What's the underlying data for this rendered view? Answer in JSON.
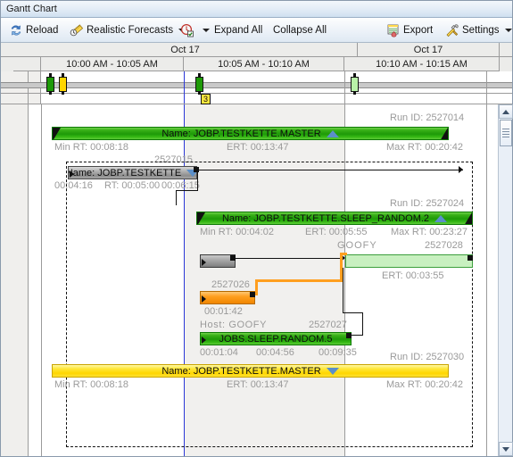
{
  "window": {
    "title": "Gantt Chart"
  },
  "toolbar": {
    "reload": {
      "label": "Reload",
      "icon": "reload-icon"
    },
    "forecasts": {
      "label": "Realistic Forecasts",
      "icon": "forecast-ruler-icon"
    },
    "filter": {
      "label": "",
      "icon": "filter-clock-icon"
    },
    "expand_all": {
      "label": "Expand All"
    },
    "collapse_all": {
      "label": "Collapse All"
    },
    "export": {
      "label": "Export",
      "icon": "export-icon"
    },
    "settings": {
      "label": "Settings",
      "icon": "settings-tools-icon"
    }
  },
  "timescale": {
    "days": [
      {
        "label": "Oct 17"
      },
      {
        "label": "Oct 17"
      }
    ],
    "slots": [
      {
        "label": "10:00 AM - 10:05 AM"
      },
      {
        "label": "10:05 AM - 10:10 AM"
      },
      {
        "label": "10:10 AM - 10:15 AM"
      }
    ]
  },
  "markers": {
    "badge_label": "3",
    "items": [
      {
        "name": "marker-green-1",
        "color": "#1e9a08"
      },
      {
        "name": "marker-yellow-1",
        "color": "#ffd600"
      },
      {
        "name": "marker-green-2",
        "color": "#1e9a08"
      },
      {
        "name": "marker-lightgreen-3",
        "color": "#9bee8a"
      }
    ]
  },
  "rows": [
    {
      "id": "row-master-green",
      "run_id": "Run ID: 2527014",
      "bar_label": "Name: JOBP.TESTKETTE.MASTER",
      "min_rt": "Min RT: 00:08:18",
      "ert": "ERT: 00:13:47",
      "max_rt": "Max RT: 00:20:42",
      "tail_id": "2527015",
      "color": "#1e9a08",
      "expander": "triangle-up"
    },
    {
      "id": "row-testkette-gray",
      "bar_label": "Name: JOBP.TESTKETTE",
      "t_start": "00:04:16",
      "t_rt": "RT: 00:05:00",
      "t_end": "00:06:15",
      "color": "#8d8d8d",
      "expander": "triangle-down"
    },
    {
      "id": "row-sleep-random-2",
      "run_id": "Run ID: 2527024",
      "bar_label": "Name: JOBP.TESTKETTE.SLEEP_RANDOM.2",
      "min_rt": "Min RT: 00:04:02",
      "ert": "ERT: 00:05:55",
      "max_rt": "Max RT: 00:23:27",
      "color": "#1e9a08",
      "expander": "triangle-up"
    },
    {
      "id": "row-goofy-ltgreen",
      "host": "GOOFY",
      "run_id": "2527028",
      "ert": "ERT: 00:03:55",
      "color": "#c8f0c0"
    },
    {
      "id": "row-orange",
      "run_id": "2527026",
      "duration": "00:01:42",
      "color": "#ff9f1f"
    },
    {
      "id": "row-jobs-sleep-random-5",
      "host": "Host: GOOFY",
      "run_id": "2527027",
      "bar_label": "JOBS.SLEEP.RANDOM.5",
      "t_start": "00:01:04",
      "t_mid": "00:04:56",
      "t_end": "00:09:35",
      "color": "#1e9a08"
    },
    {
      "id": "row-master-yellow",
      "run_id": "Run ID: 2527030",
      "bar_label": "Name: JOBP.TESTKETTE.MASTER",
      "min_rt": "Min RT: 00:08:18",
      "ert": "ERT: 00:13:47",
      "max_rt": "Max RT: 00:20:42",
      "color": "#ffd600",
      "expander": "triangle-down"
    }
  ],
  "scroll": {
    "vertical": {
      "up": "scroll-up-arrow",
      "down": "scroll-down-arrow"
    },
    "horizontal": {
      "left": "scroll-left-arrow",
      "right": "scroll-right-arrow"
    }
  },
  "colors": {
    "accent_green": "#1e9a08",
    "accent_yellow": "#ffd600",
    "accent_orange": "#ff9f1f",
    "marker_badge": "#ffe83d",
    "now_line": "#2b37d8"
  }
}
